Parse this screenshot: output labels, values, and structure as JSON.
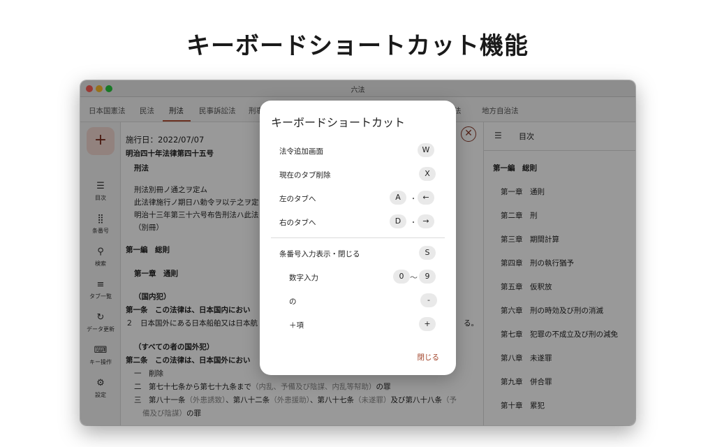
{
  "headline": "キーボードショートカット機能",
  "window": {
    "title": "六法"
  },
  "tabs": [
    {
      "label": "日本国憲法",
      "active": false
    },
    {
      "label": "民法",
      "active": false
    },
    {
      "label": "刑法",
      "active": true
    },
    {
      "label": "民事訴訟法",
      "active": false
    },
    {
      "label": "刑事",
      "active": false
    },
    {
      "label": "法",
      "active": false
    },
    {
      "label": "地方自治法",
      "active": false
    }
  ],
  "fab": {
    "label": "+"
  },
  "rail": [
    {
      "icon": "☰",
      "label": "目次",
      "icon_name": "list-icon"
    },
    {
      "icon": "⣿",
      "label": "条番号",
      "icon_name": "dots-grid-icon"
    },
    {
      "icon": "⚲",
      "label": "検索",
      "icon_name": "search-icon"
    },
    {
      "icon": "≡",
      "label": "タブ一覧",
      "icon_name": "tabs-list-icon"
    },
    {
      "icon": "↻",
      "label": "データ更新",
      "icon_name": "refresh-icon"
    },
    {
      "icon": "⌨",
      "label": "キー操作",
      "icon_name": "keyboard-icon"
    },
    {
      "icon": "⚙",
      "label": "設定",
      "icon_name": "gear-icon"
    }
  ],
  "document": {
    "date": "施行日：2022/07/07",
    "law_number": "明治四十年法律第四十五号",
    "law_name": "刑法",
    "preamble": [
      "刑法別冊ノ通之ヲ定ム",
      "此法律施行ノ期日ハ勅令ヲ以テ之ヲ定",
      "明治十三年第三十六号布告刑法ハ此法",
      "（別冊）"
    ],
    "part": "第一編　総則",
    "chapter": "第一章　通則",
    "heading1": "（国内犯）",
    "art1": "第一条　この法律は、日本国内におい",
    "art1_2": "２　日本国外にある日本船舶又は日本航",
    "art1_2_tail": "る。",
    "heading2": "（すべての者の国外犯）",
    "art2": "第二条　この法律は、日本国外におい",
    "item1": "一　削除",
    "item2_a": "二　第七十七条から第七十九条まで",
    "item2_b": "（内乱、予備及び陰謀、内乱等幇助）",
    "item2_c": "の罪",
    "item3_a": "三　第八十一条",
    "item3_b": "（外患誘致）",
    "item3_c": "、第八十二条",
    "item3_d": "（外患援助）",
    "item3_e": "、第八十七条",
    "item3_f": "（未遂罪）",
    "item3_g": "及び第八十八条",
    "item3_h": "（予",
    "item3_i": "備及び陰謀）",
    "item3_j": "の罪"
  },
  "toc": {
    "title": "目次",
    "items": [
      "第一編　総則",
      "第一章　通則",
      "第二章　刑",
      "第三章　期間計算",
      "第四章　刑の執行猶予",
      "第五章　仮釈放",
      "第六章　刑の時効及び刑の消滅",
      "第七章　犯罪の不成立及び刑の減免",
      "第八章　未遂罪",
      "第九章　併合罪",
      "第十章　累犯"
    ]
  },
  "dialog": {
    "title": "キーボードショートカット",
    "shortcuts": {
      "add": {
        "label": "法令追加画面",
        "key": "W"
      },
      "close_tab": {
        "label": "現在のタブ削除",
        "key": "X"
      },
      "left_tab": {
        "label": "左のタブへ",
        "key1": "A",
        "sep": "・",
        "key2": "←"
      },
      "right_tab": {
        "label": "右のタブへ",
        "key1": "D",
        "sep": "・",
        "key2": "→"
      },
      "article": {
        "label": "条番号入力表示・閉じる",
        "key": "S"
      },
      "digits": {
        "label": "数字入力",
        "key1": "0",
        "sep": "〜",
        "key2": "9"
      },
      "no": {
        "label": "の",
        "key": "-"
      },
      "kou": {
        "label": "＋項",
        "key": "+"
      }
    },
    "close_label": "閉じる"
  }
}
